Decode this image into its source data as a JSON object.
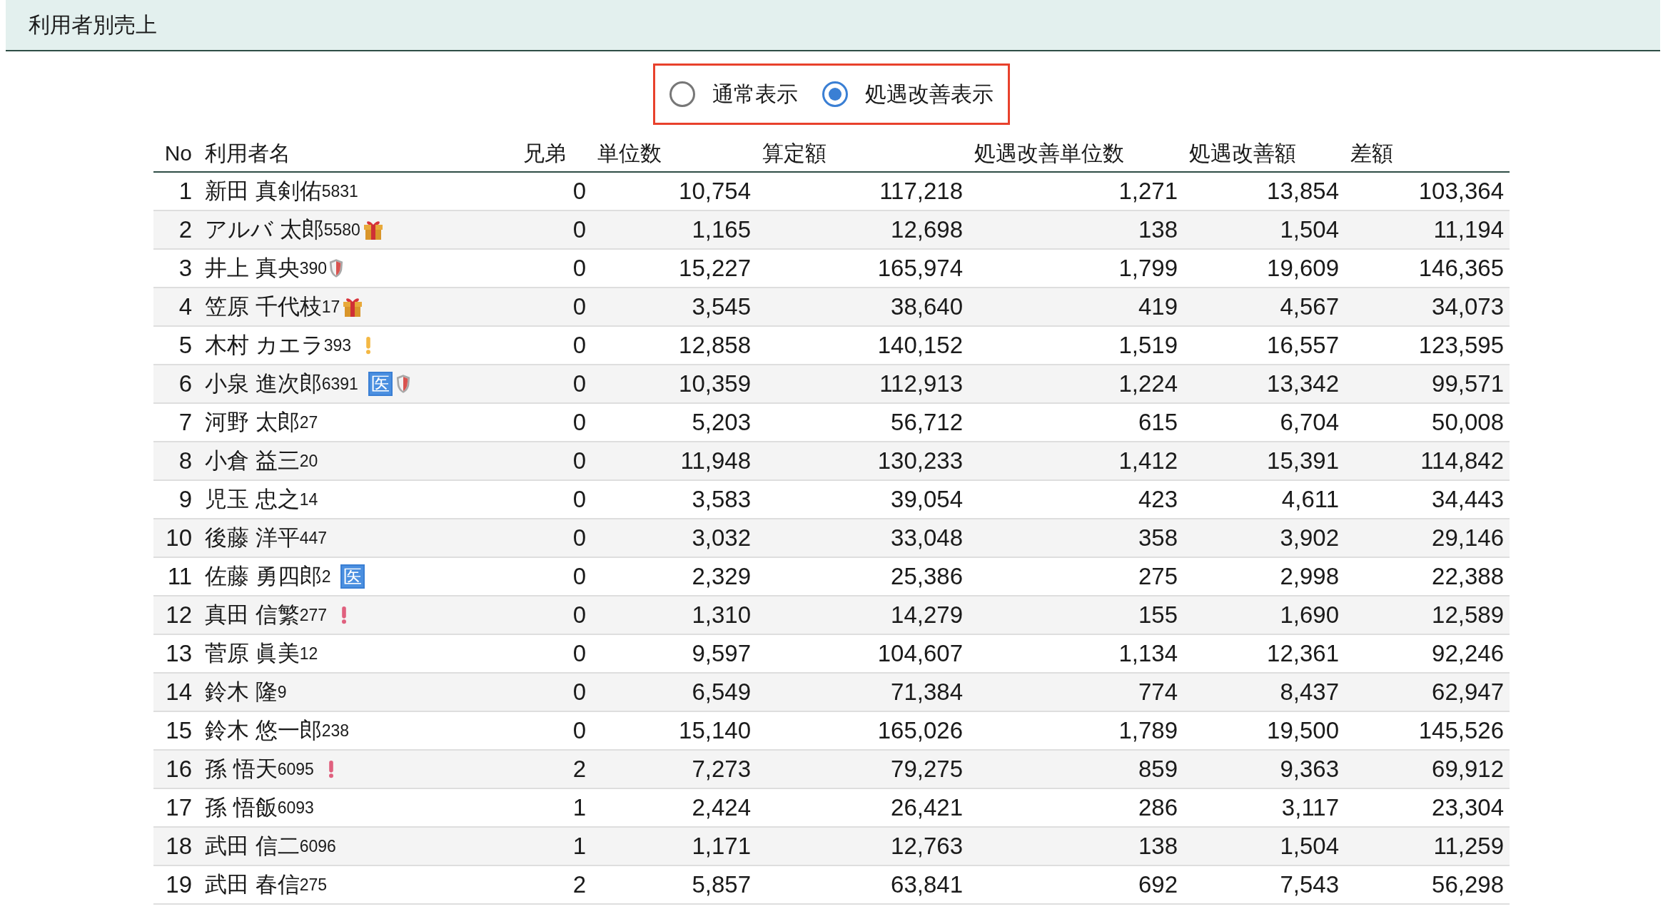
{
  "header": {
    "title": "利用者別売上"
  },
  "display_mode": [
    {
      "label": "通常表示",
      "selected": false
    },
    {
      "label": "処遇改善表示",
      "selected": true
    }
  ],
  "table": {
    "columns": [
      "No",
      "利用者名",
      "兄弟",
      "単位数",
      "算定額",
      "処遇改善単位数",
      "処遇改善額",
      "差額"
    ],
    "rows": [
      {
        "no": "1",
        "name": "新田 真剣佑",
        "id": "5831",
        "icons": [],
        "siblings": "0",
        "units": "10,754",
        "amount": "117,218",
        "improve_units": "1,271",
        "improve_amount": "13,854",
        "diff": "103,364"
      },
      {
        "no": "2",
        "name": "アルバ 太郎",
        "id": "5580",
        "icons": [
          {
            "kind": "gift"
          }
        ],
        "siblings": "0",
        "units": "1,165",
        "amount": "12,698",
        "improve_units": "138",
        "improve_amount": "1,504",
        "diff": "11,194"
      },
      {
        "no": "3",
        "name": "井上 真央",
        "id": "390",
        "icons": [
          {
            "kind": "shield"
          }
        ],
        "siblings": "0",
        "units": "15,227",
        "amount": "165,974",
        "improve_units": "1,799",
        "improve_amount": "19,609",
        "diff": "146,365"
      },
      {
        "no": "4",
        "name": "笠原 千代枝",
        "id": "17",
        "icons": [
          {
            "kind": "gift"
          }
        ],
        "siblings": "0",
        "units": "3,545",
        "amount": "38,640",
        "improve_units": "419",
        "improve_amount": "4,567",
        "diff": "34,073"
      },
      {
        "no": "5",
        "name": "木村 カエラ",
        "id": "393",
        "icons": [
          {
            "kind": "alert",
            "color": "#f4b844"
          }
        ],
        "siblings": "0",
        "units": "12,858",
        "amount": "140,152",
        "improve_units": "1,519",
        "improve_amount": "16,557",
        "diff": "123,595"
      },
      {
        "no": "6",
        "name": "小泉 進次郎",
        "id": "6391",
        "icons": [
          {
            "kind": "badge",
            "text": "医"
          },
          {
            "kind": "shield"
          }
        ],
        "siblings": "0",
        "units": "10,359",
        "amount": "112,913",
        "improve_units": "1,224",
        "improve_amount": "13,342",
        "diff": "99,571"
      },
      {
        "no": "7",
        "name": "河野 太郎",
        "id": "27",
        "icons": [],
        "siblings": "0",
        "units": "5,203",
        "amount": "56,712",
        "improve_units": "615",
        "improve_amount": "6,704",
        "diff": "50,008"
      },
      {
        "no": "8",
        "name": "小倉 益三",
        "id": "20",
        "icons": [],
        "siblings": "0",
        "units": "11,948",
        "amount": "130,233",
        "improve_units": "1,412",
        "improve_amount": "15,391",
        "diff": "114,842"
      },
      {
        "no": "9",
        "name": "児玉 忠之",
        "id": "14",
        "icons": [],
        "siblings": "0",
        "units": "3,583",
        "amount": "39,054",
        "improve_units": "423",
        "improve_amount": "4,611",
        "diff": "34,443"
      },
      {
        "no": "10",
        "name": "後藤 洋平",
        "id": "447",
        "icons": [],
        "siblings": "0",
        "units": "3,032",
        "amount": "33,048",
        "improve_units": "358",
        "improve_amount": "3,902",
        "diff": "29,146"
      },
      {
        "no": "11",
        "name": "佐藤 勇四郎",
        "id": "2",
        "icons": [
          {
            "kind": "badge",
            "text": "医"
          }
        ],
        "siblings": "0",
        "units": "2,329",
        "amount": "25,386",
        "improve_units": "275",
        "improve_amount": "2,998",
        "diff": "22,388"
      },
      {
        "no": "12",
        "name": "真田 信繁",
        "id": "277",
        "icons": [
          {
            "kind": "alert",
            "color": "#e0607e"
          }
        ],
        "siblings": "0",
        "units": "1,310",
        "amount": "14,279",
        "improve_units": "155",
        "improve_amount": "1,690",
        "diff": "12,589"
      },
      {
        "no": "13",
        "name": "菅原 眞美",
        "id": "12",
        "icons": [],
        "siblings": "0",
        "units": "9,597",
        "amount": "104,607",
        "improve_units": "1,134",
        "improve_amount": "12,361",
        "diff": "92,246"
      },
      {
        "no": "14",
        "name": "鈴木 隆",
        "id": "9",
        "icons": [],
        "siblings": "0",
        "units": "6,549",
        "amount": "71,384",
        "improve_units": "774",
        "improve_amount": "8,437",
        "diff": "62,947"
      },
      {
        "no": "15",
        "name": "鈴木 悠一郎",
        "id": "238",
        "icons": [],
        "siblings": "0",
        "units": "15,140",
        "amount": "165,026",
        "improve_units": "1,789",
        "improve_amount": "19,500",
        "diff": "145,526"
      },
      {
        "no": "16",
        "name": "孫 悟天",
        "id": "6095",
        "icons": [
          {
            "kind": "alert",
            "color": "#e0607e"
          }
        ],
        "siblings": "2",
        "units": "7,273",
        "amount": "79,275",
        "improve_units": "859",
        "improve_amount": "9,363",
        "diff": "69,912"
      },
      {
        "no": "17",
        "name": "孫 悟飯",
        "id": "6093",
        "icons": [],
        "siblings": "1",
        "units": "2,424",
        "amount": "26,421",
        "improve_units": "286",
        "improve_amount": "3,117",
        "diff": "23,304"
      },
      {
        "no": "18",
        "name": "武田 信二",
        "id": "6096",
        "icons": [],
        "siblings": "1",
        "units": "1,171",
        "amount": "12,763",
        "improve_units": "138",
        "improve_amount": "1,504",
        "diff": "11,259"
      },
      {
        "no": "19",
        "name": "武田 春信",
        "id": "275",
        "icons": [],
        "siblings": "2",
        "units": "5,857",
        "amount": "63,841",
        "improve_units": "692",
        "improve_amount": "7,543",
        "diff": "56,298"
      }
    ]
  }
}
